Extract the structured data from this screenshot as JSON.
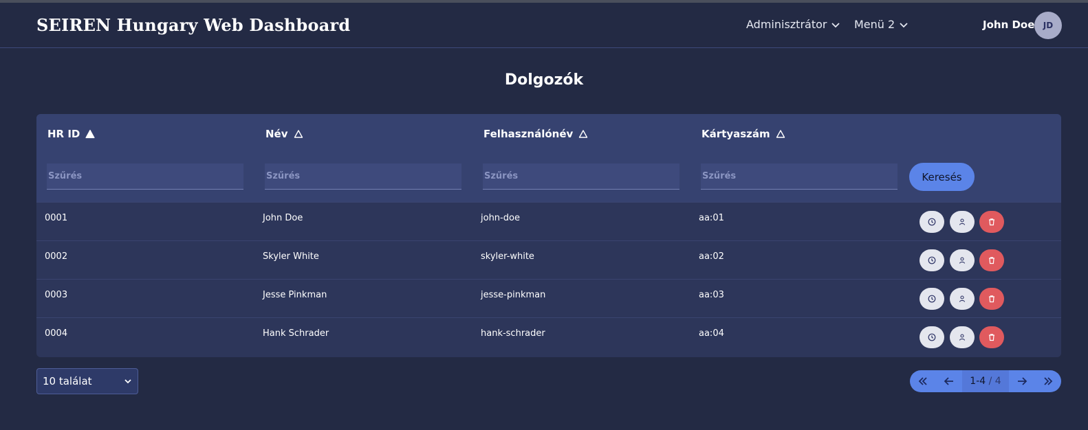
{
  "app": {
    "title": "SEIREN Hungary Web Dashboard"
  },
  "nav": {
    "menus": [
      {
        "label": "Adminisztrátor"
      },
      {
        "label": "Menü 2"
      }
    ],
    "user": {
      "name": "John Doe",
      "initials": "JD"
    }
  },
  "page": {
    "title": "Dolgozók"
  },
  "table": {
    "columns": [
      {
        "label": "HR ID",
        "sort": "ascending"
      },
      {
        "label": "Név",
        "sort": "none"
      },
      {
        "label": "Felhasználónév",
        "sort": "none"
      },
      {
        "label": "Kártyaszám",
        "sort": "none"
      }
    ],
    "filter_placeholder": "Szűrés",
    "search_label": "Keresés",
    "rows": [
      {
        "hr_id": "0001",
        "name": "John Doe",
        "username": "john-doe",
        "card": "aa:01"
      },
      {
        "hr_id": "0002",
        "name": "Skyler White",
        "username": "skyler-white",
        "card": "aa:02"
      },
      {
        "hr_id": "0003",
        "name": "Jesse Pinkman",
        "username": "jesse-pinkman",
        "card": "aa:03"
      },
      {
        "hr_id": "0004",
        "name": "Hank Schrader",
        "username": "hank-schrader",
        "card": "aa:04"
      }
    ],
    "row_actions": [
      "clock-icon",
      "user-icon",
      "trash-icon"
    ]
  },
  "footer": {
    "page_size": "10 találat",
    "pagination": {
      "range": "1-4",
      "separator": "/",
      "total": "4"
    }
  },
  "colors": {
    "background": "#232a44",
    "header_band": "#364270",
    "accent": "#5b84e8",
    "danger": "#e05a5e"
  }
}
